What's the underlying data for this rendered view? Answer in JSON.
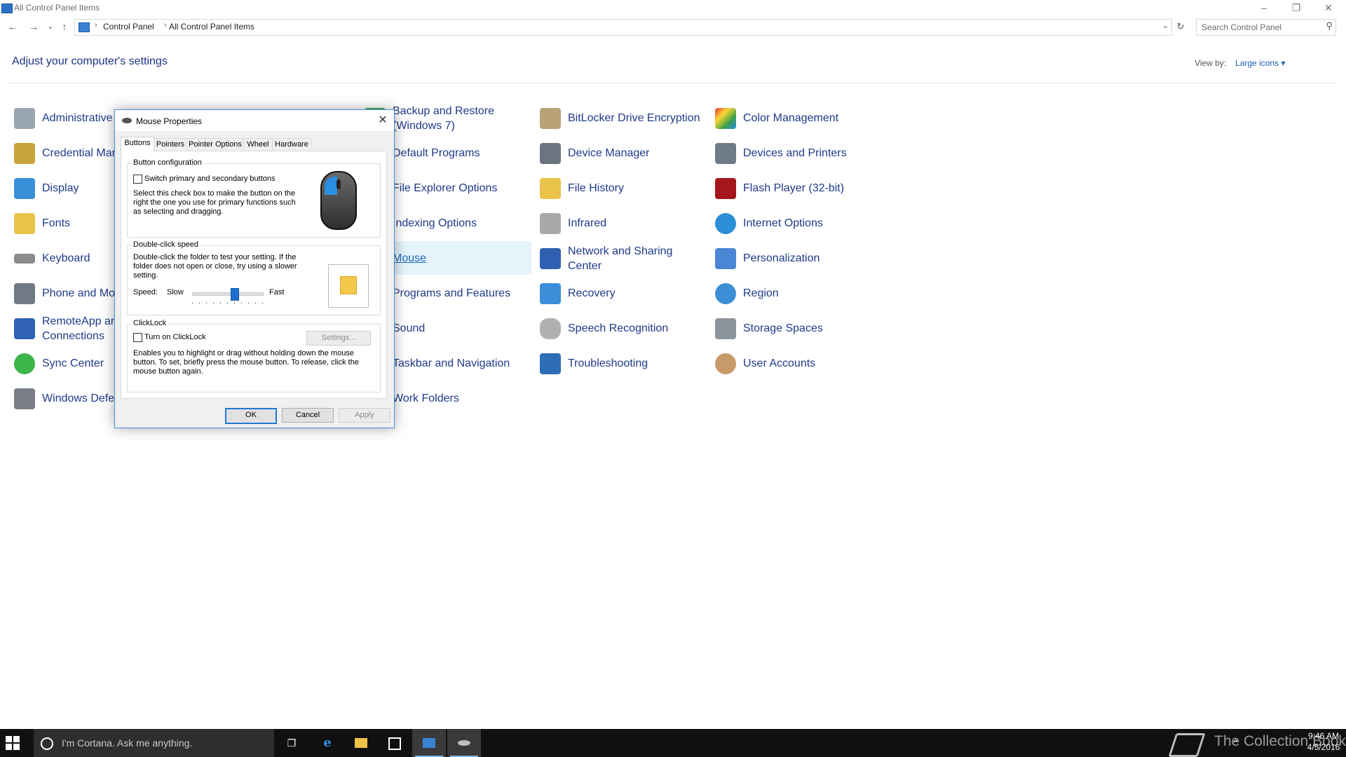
{
  "window": {
    "title": "All Control Panel Items",
    "minimize_glyph": "–",
    "restore_glyph": "❐",
    "close_glyph": "✕"
  },
  "nav": {
    "back_glyph": "←",
    "forward_glyph": "→",
    "recent_glyph": "⌄",
    "up_glyph": "↑",
    "breadcrumb": [
      "Control Panel",
      "All Control Panel Items"
    ],
    "breadcrumb_sep": "›",
    "dropdown_glyph": "⌄",
    "refresh_glyph": "↻",
    "search_placeholder": "Search Control Panel",
    "search_glyph": "⚲"
  },
  "header": {
    "title": "Adjust your computer's settings",
    "view_by_label": "View by:",
    "view_by_value": "Large icons ▾"
  },
  "items": {
    "administrative": "Administrative",
    "credential": "Credential Mar",
    "display": "Display",
    "fonts": "Fonts",
    "keyboard": "Keyboard",
    "phone": "Phone and Mo",
    "remoteapp_1": "RemoteApp an",
    "remoteapp_2": "Connections",
    "sync": "Sync Center",
    "windows_def": "Windows Defe",
    "backup_1": "Backup and Restore",
    "backup_2": "(Windows 7)",
    "default_programs": "Default Programs",
    "file_explorer": "File Explorer Options",
    "indexing": "Indexing Options",
    "mouse": "Mouse",
    "programs": "Programs and Features",
    "sound": "Sound",
    "taskbar": "Taskbar and Navigation",
    "work_folders": "Work Folders",
    "bitlocker": "BitLocker Drive Encryption",
    "device_manager": "Device Manager",
    "file_history": "File History",
    "infrared": "Infrared",
    "network_1": "Network and Sharing",
    "network_2": "Center",
    "recovery": "Recovery",
    "speech": "Speech Recognition",
    "troubleshooting": "Troubleshooting",
    "color": "Color Management",
    "devices_printers": "Devices and Printers",
    "flash": "Flash Player (32-bit)",
    "internet": "Internet Options",
    "personalization": "Personalization",
    "region": "Region",
    "storage": "Storage Spaces",
    "users": "User Accounts"
  },
  "dialog": {
    "title": "Mouse Properties",
    "close_glyph": "✕",
    "tabs": [
      "Buttons",
      "Pointers",
      "Pointer Options",
      "Wheel",
      "Hardware"
    ],
    "button_config": {
      "legend": "Button configuration",
      "checkbox_label": "Switch primary and secondary buttons",
      "desc_lines": [
        "Select this check box to make the button on the",
        "right the one you use for primary functions such",
        "as selecting and dragging."
      ]
    },
    "double_click": {
      "legend": "Double-click speed",
      "desc_lines": [
        "Double-click the folder to test your setting. If the",
        "folder does not open or close, try using a slower",
        "setting."
      ],
      "speed_label": "Speed:",
      "slow_label": "Slow",
      "fast_label": "Fast",
      "speed_value": 0.6
    },
    "clicklock": {
      "legend": "ClickLock",
      "checkbox_label": "Turn on ClickLock",
      "settings_button": "Settings...",
      "desc_lines": [
        "Enables you to highlight or drag without holding down the mouse",
        "button. To set, briefly press the mouse button. To release, click the",
        "mouse button again."
      ]
    },
    "ok": "OK",
    "cancel": "Cancel",
    "apply": "Apply"
  },
  "taskbar": {
    "cortana_text": "I'm Cortana. Ask me anything.",
    "watermark": "The Collection Book",
    "time": "9:46 AM",
    "date": "4/5/2016",
    "tray_up_glyph": "^"
  },
  "colors": {
    "link": "#1f3a8a",
    "heading": "#1e3287",
    "accent": "#1f6fcf",
    "taskbar": "#101010",
    "highlight": "#e5f3fb"
  }
}
